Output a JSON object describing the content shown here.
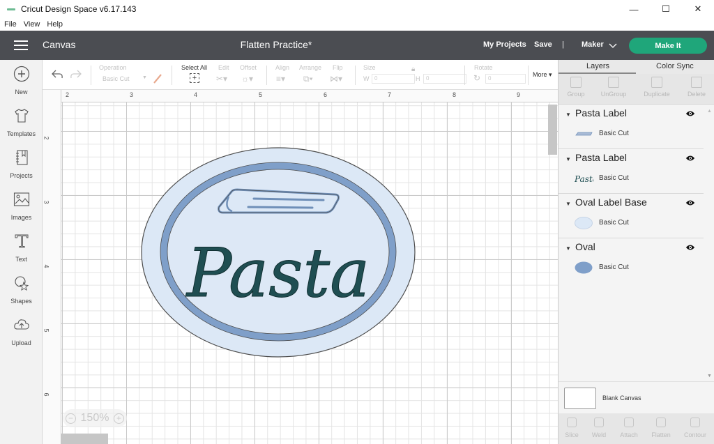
{
  "window": {
    "title": "Cricut Design Space  v6.17.143",
    "controls": {
      "minimize": "—",
      "maximize": "☐",
      "close": "✕"
    }
  },
  "menu": [
    "File",
    "View",
    "Help"
  ],
  "header": {
    "section": "Canvas",
    "document_title": "Flatten Practice*",
    "my_projects": "My Projects",
    "save": "Save",
    "divider": "|",
    "machine": "Maker",
    "make_it": "Make It",
    "accent_color": "#1fa67a"
  },
  "sidebar": {
    "items": [
      {
        "label": "New",
        "icon": "plus-circle-icon"
      },
      {
        "label": "Templates",
        "icon": "tshirt-icon"
      },
      {
        "label": "Projects",
        "icon": "notebook-icon"
      },
      {
        "label": "Images",
        "icon": "image-icon"
      },
      {
        "label": "Text",
        "icon": "text-icon"
      },
      {
        "label": "Shapes",
        "icon": "shapes-icon"
      },
      {
        "label": "Upload",
        "icon": "cloud-upload-icon"
      }
    ]
  },
  "toolbar": {
    "operation_label": "Operation",
    "operation_value": "Basic Cut",
    "select_all": "Select All",
    "edit": "Edit",
    "offset": "Offset",
    "align": "Align",
    "arrange": "Arrange",
    "flip": "Flip",
    "size": "Size",
    "size_w_label": "W",
    "size_w_value": "0",
    "size_h_label": "H",
    "size_h_value": "0",
    "rotate": "Rotate",
    "rotate_value": "0",
    "more": "More ▾"
  },
  "rulers": {
    "top": [
      "2",
      "3",
      "4",
      "5",
      "6",
      "7",
      "8",
      "9"
    ],
    "left": [
      "2",
      "3",
      "4",
      "5",
      "6"
    ]
  },
  "canvas": {
    "zoom": "150%",
    "design": {
      "word": "Pasta",
      "colors": {
        "outer_oval": "#dce8f6",
        "ring": "#7f9fc9",
        "inner_oval": "#dde8f6",
        "lettering": "#1f4e52",
        "outline": "#4c4c4c"
      }
    }
  },
  "panel": {
    "tabs": [
      "Layers",
      "Color Sync"
    ],
    "active_tab": "Layers",
    "actions": [
      "Group",
      "UnGroup",
      "Duplicate",
      "Delete"
    ],
    "layers": [
      {
        "name": "Pasta Label",
        "operation": "Basic Cut",
        "thumb": "pasta-noodle",
        "thumb_color": "#8ea6c8"
      },
      {
        "name": "Pasta Label",
        "operation": "Basic Cut",
        "thumb": "pasta-text",
        "thumb_color": "#1f4e52"
      },
      {
        "name": "Oval Label Base",
        "operation": "Basic Cut",
        "thumb": "oval",
        "thumb_color": "#dce8f6"
      },
      {
        "name": "Oval",
        "operation": "Basic Cut",
        "thumb": "oval",
        "thumb_color": "#7f9fc9"
      }
    ],
    "blank_canvas": "Blank Canvas",
    "bottom_actions": [
      "Slice",
      "Weld",
      "Attach",
      "Flatten",
      "Contour"
    ]
  }
}
